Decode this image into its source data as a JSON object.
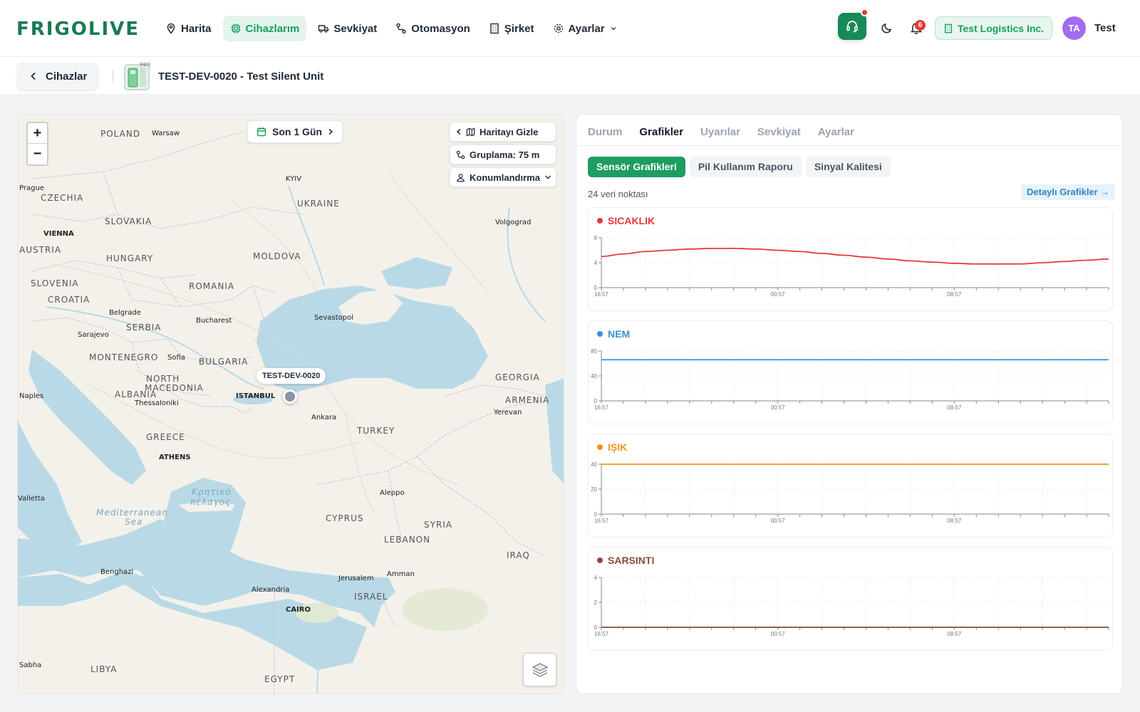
{
  "header": {
    "logo": "FRIGOLIVE",
    "nav": [
      {
        "label": "Harita",
        "icon": "map-pin-icon",
        "active": false
      },
      {
        "label": "Cihazlarım",
        "icon": "chip-icon",
        "active": true
      },
      {
        "label": "Sevkiyat",
        "icon": "truck-icon",
        "active": false
      },
      {
        "label": "Otomasyon",
        "icon": "route-icon",
        "active": false
      },
      {
        "label": "Şirket",
        "icon": "building-icon",
        "active": false
      },
      {
        "label": "Ayarlar",
        "icon": "gear-icon",
        "active": false
      }
    ],
    "notification_count": "6",
    "company": "Test Logistics Inc.",
    "avatar_initials": "TA",
    "user_name": "Test"
  },
  "subheader": {
    "back_label": "Cihazlar",
    "badge": "PRO",
    "device_title": "TEST-DEV-0020 - Test Silent Unit"
  },
  "map": {
    "date_range": "Son 1 Gün",
    "hide_map": "Haritayı Gizle",
    "grouping": "Gruplama: 75 m",
    "positioning": "Konumlandırma",
    "device_tag": "TEST-DEV-0020",
    "labels": [
      {
        "text": "POLAND",
        "kind": "country"
      },
      {
        "text": "Warsaw",
        "kind": "city"
      },
      {
        "text": "Prague",
        "kind": "city"
      },
      {
        "text": "CZECHIA",
        "kind": "country"
      },
      {
        "text": "KYIV",
        "kind": "city"
      },
      {
        "text": "UKRAINE",
        "kind": "country"
      },
      {
        "text": "Volgograd",
        "kind": "city"
      },
      {
        "text": "SLOVAKIA",
        "kind": "country"
      },
      {
        "text": "VIENNA",
        "kind": "city"
      },
      {
        "text": "AUSTRIA",
        "kind": "country"
      },
      {
        "text": "HUNGARY",
        "kind": "country"
      },
      {
        "text": "MOLDOVA",
        "kind": "country"
      },
      {
        "text": "SLOVENIA",
        "kind": "country"
      },
      {
        "text": "ROMANIA",
        "kind": "country"
      },
      {
        "text": "CROATIA",
        "kind": "country"
      },
      {
        "text": "Belgrade",
        "kind": "city"
      },
      {
        "text": "Bucharest",
        "kind": "city"
      },
      {
        "text": "Sevastopol",
        "kind": "city"
      },
      {
        "text": "SERBIA",
        "kind": "country"
      },
      {
        "text": "Sarajevo",
        "kind": "city"
      },
      {
        "text": "MONTENEGRO",
        "kind": "country"
      },
      {
        "text": "Sofia",
        "kind": "city"
      },
      {
        "text": "BULGARIA",
        "kind": "country"
      },
      {
        "text": "NORTH",
        "kind": "country"
      },
      {
        "text": "MACEDONIA",
        "kind": "country"
      },
      {
        "text": "ALBANIA",
        "kind": "country"
      },
      {
        "text": "ISTANBUL",
        "kind": "city"
      },
      {
        "text": "GEORGIA",
        "kind": "country"
      },
      {
        "text": "ARMENIA",
        "kind": "country"
      },
      {
        "text": "Yerevan",
        "kind": "city"
      },
      {
        "text": "Naples",
        "kind": "city"
      },
      {
        "text": "Thessaloniki",
        "kind": "city"
      },
      {
        "text": "Ankara",
        "kind": "city"
      },
      {
        "text": "TURKEY",
        "kind": "country"
      },
      {
        "text": "GREECE",
        "kind": "country"
      },
      {
        "text": "ATHENS",
        "kind": "city"
      },
      {
        "text": "Κρητικό",
        "kind": "sea"
      },
      {
        "text": "πέλαγος",
        "kind": "sea"
      },
      {
        "text": "Valletta",
        "kind": "city"
      },
      {
        "text": "Mediterranean",
        "kind": "sea"
      },
      {
        "text": "Sea",
        "kind": "sea"
      },
      {
        "text": "Aleppo",
        "kind": "city"
      },
      {
        "text": "CYPRUS",
        "kind": "country"
      },
      {
        "text": "SYRIA",
        "kind": "country"
      },
      {
        "text": "LEBANON",
        "kind": "country"
      },
      {
        "text": "IRAQ",
        "kind": "country"
      },
      {
        "text": "Benghazi",
        "kind": "city"
      },
      {
        "text": "Jerusalem",
        "kind": "city"
      },
      {
        "text": "Amman",
        "kind": "city"
      },
      {
        "text": "Alexandria",
        "kind": "city"
      },
      {
        "text": "ISRAEL",
        "kind": "country"
      },
      {
        "text": "CAIRO",
        "kind": "city"
      },
      {
        "text": "Sabha",
        "kind": "city"
      },
      {
        "text": "LIBYA",
        "kind": "country"
      },
      {
        "text": "EGYPT",
        "kind": "country"
      }
    ]
  },
  "panel": {
    "tabs": [
      "Durum",
      "Grafikler",
      "Uyarılar",
      "Sevkiyat",
      "Ayarlar"
    ],
    "active_tab": "Grafikler",
    "subtabs": [
      "Sensör Grafikleri",
      "Pil Kullanım Raporu",
      "Sinyal Kalitesi"
    ],
    "active_subtab": "Sensör Grafikleri",
    "points_label": "24 veri noktası",
    "detail_label": "Detaylı Grafikler →"
  },
  "chart_data": [
    {
      "type": "line",
      "title": "SICAKLIK",
      "color": "#e53935",
      "x": [
        "16:57",
        "00:57",
        "08:57"
      ],
      "ylim": [
        0,
        8
      ],
      "yticks": [
        0,
        4,
        8
      ],
      "values": [
        5.0,
        5.4,
        5.8,
        6.0,
        6.2,
        6.3,
        6.3,
        6.2,
        6.0,
        5.8,
        5.5,
        5.2,
        4.9,
        4.6,
        4.3,
        4.1,
        3.9,
        3.8,
        3.8,
        3.8,
        4.0,
        4.2,
        4.4,
        4.6
      ]
    },
    {
      "type": "line",
      "title": "NEM",
      "color": "#3a8fd6",
      "x": [
        "16:57",
        "00:57",
        "08:57"
      ],
      "ylim": [
        0,
        80
      ],
      "yticks": [
        0,
        40,
        80
      ],
      "values": [
        66,
        66,
        66,
        66,
        66,
        66,
        66,
        66,
        66,
        66,
        66,
        66,
        66,
        66,
        66,
        66,
        66,
        66,
        66,
        66,
        66,
        66,
        66,
        66
      ]
    },
    {
      "type": "line",
      "title": "IŞIK",
      "color": "#f0961e",
      "x": [
        "16:57",
        "00:57",
        "08:57"
      ],
      "ylim": [
        0,
        40
      ],
      "yticks": [
        0,
        20,
        40
      ],
      "values": [
        40,
        40,
        40,
        40,
        40,
        40,
        40,
        40,
        40,
        40,
        40,
        40,
        40,
        40,
        40,
        40,
        40,
        40,
        40,
        40,
        40,
        40,
        40,
        40
      ]
    },
    {
      "type": "line",
      "title": "SARSINTI",
      "color": "#8b4a3c",
      "x": [
        "16:57",
        "00:57",
        "08:57"
      ],
      "ylim": [
        0,
        4
      ],
      "yticks": [
        0,
        2,
        4
      ],
      "values": [
        0,
        0,
        0,
        0,
        0,
        0,
        0,
        0,
        0,
        0,
        0,
        0,
        0,
        0,
        0,
        0,
        0,
        0,
        0,
        0,
        0,
        0,
        0,
        0
      ]
    }
  ]
}
